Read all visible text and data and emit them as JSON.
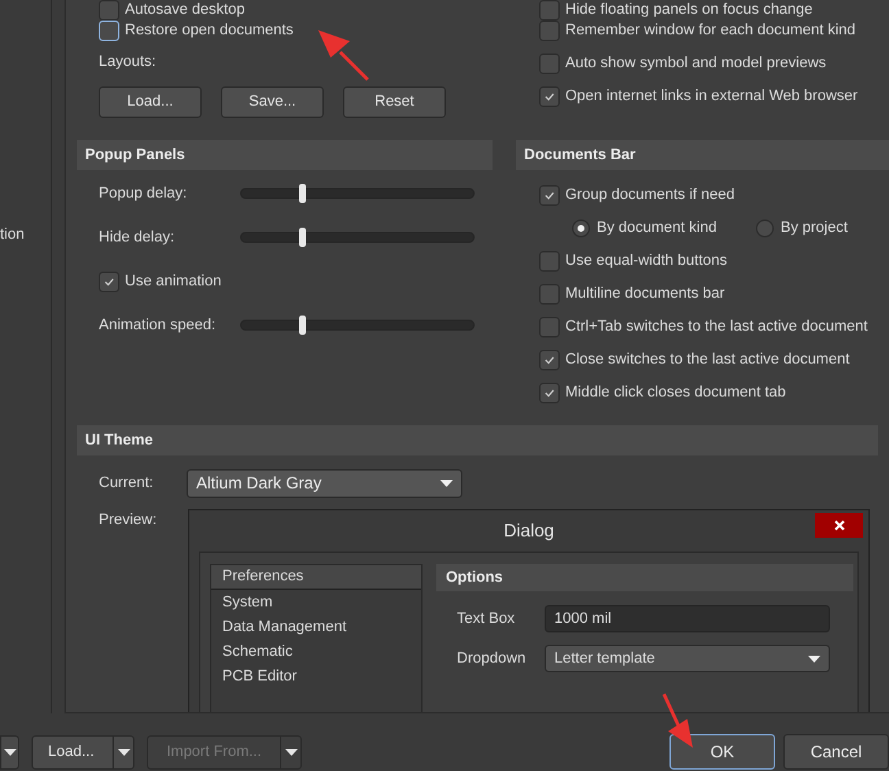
{
  "sidebar": {
    "text": "tion"
  },
  "general_left": {
    "checkboxes": [
      {
        "label": "Autosave desktop",
        "checked": false,
        "focused": false
      },
      {
        "label": "Restore open documents",
        "checked": false,
        "focused": true
      }
    ],
    "layouts_label": "Layouts:",
    "layout_buttons": [
      "Load...",
      "Save...",
      "Reset"
    ]
  },
  "general_right": {
    "checkboxes": [
      {
        "label": "Hide floating panels on focus change",
        "checked": false
      },
      {
        "label": "Remember window for each document kind",
        "checked": false
      },
      {
        "label": "Auto show symbol and model previews",
        "checked": false
      },
      {
        "label": "Open internet links in external Web browser",
        "checked": true
      }
    ]
  },
  "popup_panels": {
    "title": "Popup Panels",
    "items": [
      {
        "kind": "slider",
        "label": "Popup delay:",
        "level": 0.26
      },
      {
        "kind": "slider",
        "label": "Hide delay:",
        "level": 0.26
      },
      {
        "kind": "checkbox",
        "label": "Use animation",
        "checked": true
      },
      {
        "kind": "slider",
        "label": "Animation speed:",
        "level": 0.26
      }
    ]
  },
  "documents_bar": {
    "title": "Documents Bar",
    "items": [
      {
        "kind": "checkbox",
        "label": "Group documents if need",
        "checked": true
      },
      {
        "kind": "radios",
        "options": [
          {
            "label": "By document kind",
            "selected": true
          },
          {
            "label": "By project",
            "selected": false
          }
        ]
      },
      {
        "kind": "checkbox",
        "label": "Use equal-width buttons",
        "checked": false
      },
      {
        "kind": "checkbox",
        "label": "Multiline documents bar",
        "checked": false
      },
      {
        "kind": "checkbox",
        "label": "Ctrl+Tab switches to the last active document",
        "checked": false
      },
      {
        "kind": "checkbox",
        "label": "Close switches to the last active document",
        "checked": true
      },
      {
        "kind": "checkbox",
        "label": "Middle click closes document tab",
        "checked": true
      }
    ]
  },
  "ui_theme": {
    "title": "UI Theme",
    "current_label": "Current:",
    "current_value": "Altium Dark Gray",
    "preview_label": "Preview:",
    "preview": {
      "title": "Dialog",
      "list": [
        {
          "label": "Preferences",
          "selected": true
        },
        {
          "label": "System",
          "selected": false
        },
        {
          "label": "Data Management",
          "selected": false
        },
        {
          "label": "Schematic",
          "selected": false
        },
        {
          "label": "PCB Editor",
          "selected": false
        }
      ],
      "options_title": "Options",
      "fields": [
        {
          "kind": "text",
          "label": "Text Box",
          "value": "1000 mil"
        },
        {
          "kind": "dropdown",
          "label": "Dropdown",
          "value": "Letter template"
        }
      ]
    }
  },
  "bottom_bar": {
    "left_buttons": [
      {
        "label": "Load...",
        "disabled": false
      },
      {
        "label": "Import From...",
        "disabled": true
      }
    ],
    "right_buttons": [
      {
        "label": "OK",
        "focused": true
      },
      {
        "label": "Cancel",
        "focused": false
      }
    ]
  }
}
